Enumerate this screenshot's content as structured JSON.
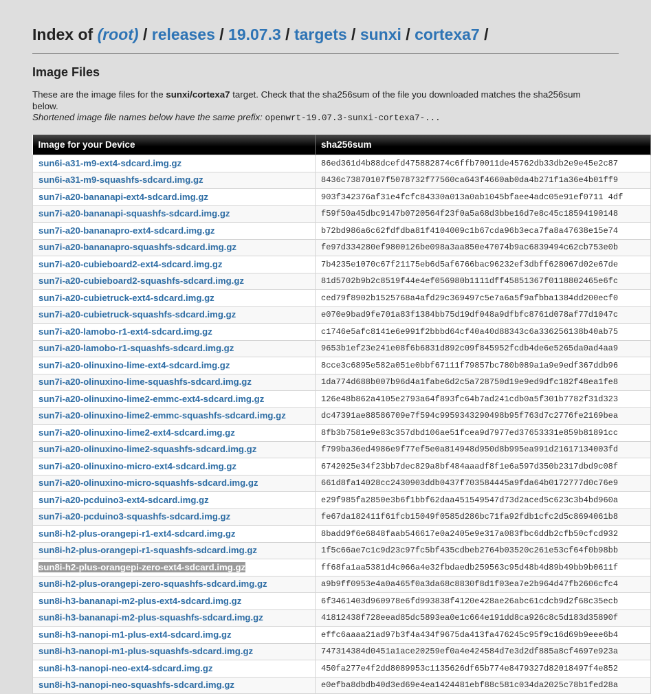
{
  "header": {
    "index_of": "Index of",
    "path": [
      {
        "label": "(root)",
        "italic": true
      },
      {
        "label": "releases"
      },
      {
        "label": "19.07.3"
      },
      {
        "label": "targets"
      },
      {
        "label": "sunxi"
      },
      {
        "label": "cortexa7"
      }
    ],
    "separator": "/"
  },
  "section": {
    "title": "Image Files",
    "intro_pre": "These are the image files for the ",
    "intro_target": "sunxi/cortexa7",
    "intro_post": " target. Check that the sha256sum of the file you downloaded matches the sha256sum below.",
    "short_label": "Shortened image file names below have the same prefix: ",
    "short_prefix": "openwrt-19.07.3-sunxi-cortexa7-..."
  },
  "table": {
    "col_image": "Image for your Device",
    "col_sha": "sha256sum",
    "selected_index": 24,
    "rows": [
      {
        "name": "sun6i-a31-m9-ext4-sdcard.img.gz",
        "sha": "86ed361d4b88dcefd475882874c6ffb70011de45762db33db2e9e45e2c87"
      },
      {
        "name": "sun6i-a31-m9-squashfs-sdcard.img.gz",
        "sha": "8436c73870107f5078732f77560ca643f4660ab0da4b271f1a36e4b01ff9"
      },
      {
        "name": "sun7i-a20-bananapi-ext4-sdcard.img.gz",
        "sha": "903f342376af31e4fcfc84330a013a0ab1045bfaee4adc05e91ef0711 4df"
      },
      {
        "name": "sun7i-a20-bananapi-squashfs-sdcard.img.gz",
        "sha": "f59f50a45dbc9147b0720564f23f0a5a68d3bbe16d7e8c45c18594190148"
      },
      {
        "name": "sun7i-a20-bananapro-ext4-sdcard.img.gz",
        "sha": "b72bd986a6c62fdfdba81f4104009c1b67cda96b3eca7fa8a47638e15e74"
      },
      {
        "name": "sun7i-a20-bananapro-squashfs-sdcard.img.gz",
        "sha": "fe97d334280ef9800126be098a3aa850e47074b9ac6839494c62cb753e0b"
      },
      {
        "name": "sun7i-a20-cubieboard2-ext4-sdcard.img.gz",
        "sha": "7b4235e1070c67f21175eb6d5af6766bac96232ef3dbff628067d02e67de"
      },
      {
        "name": "sun7i-a20-cubieboard2-squashfs-sdcard.img.gz",
        "sha": "81d5702b9b2c8519f44e4ef056980b1111dff45851367f0118802465e6fc"
      },
      {
        "name": "sun7i-a20-cubietruck-ext4-sdcard.img.gz",
        "sha": "ced79f8902b1525768a4afd29c369497c5e7a6a5f9afbba1384dd200ecf0"
      },
      {
        "name": "sun7i-a20-cubietruck-squashfs-sdcard.img.gz",
        "sha": "e070e9bad9fe701a83f1384bb75d19df048a9dfbfc8761d078af77d1047c"
      },
      {
        "name": "sun7i-a20-lamobo-r1-ext4-sdcard.img.gz",
        "sha": "c1746e5afc8141e6e991f2bbbd64cf40a40d88343c6a336256138b40ab75"
      },
      {
        "name": "sun7i-a20-lamobo-r1-squashfs-sdcard.img.gz",
        "sha": "9653b1ef23e241e08f6b6831d892c09f845952fcdb4de6e5265da0ad4aa9"
      },
      {
        "name": "sun7i-a20-olinuxino-lime-ext4-sdcard.img.gz",
        "sha": "8cce3c6895e582a051e0bbf67111f79857bc780b089a1a9e9edf367ddb96"
      },
      {
        "name": "sun7i-a20-olinuxino-lime-squashfs-sdcard.img.gz",
        "sha": "1da774d688b007b96d4a1fabe6d2c5a728750d19e9ed9dfc182f48ea1fe8"
      },
      {
        "name": "sun7i-a20-olinuxino-lime2-emmc-ext4-sdcard.img.gz",
        "sha": "126e48b862a4105e2793a64f893fc64b7ad241cdb0a5f301b7782f31d323"
      },
      {
        "name": "sun7i-a20-olinuxino-lime2-emmc-squashfs-sdcard.img.gz",
        "sha": "dc47391ae88586709e7f594c9959343290498b95f763d7c2776fe2169bea"
      },
      {
        "name": "sun7i-a20-olinuxino-lime2-ext4-sdcard.img.gz",
        "sha": "8fb3b7581e9e83c357dbd106ae51fcea9d7977ed37653331e859b81891cc"
      },
      {
        "name": "sun7i-a20-olinuxino-lime2-squashfs-sdcard.img.gz",
        "sha": "f799ba36ed4986e9f77ef5e0a814948d950d8b995ea991d21617134003fd"
      },
      {
        "name": "sun7i-a20-olinuxino-micro-ext4-sdcard.img.gz",
        "sha": "6742025e34f23bb7dec829a8bf484aaadf8f1e6a597d350b2317dbd9c08f"
      },
      {
        "name": "sun7i-a20-olinuxino-micro-squashfs-sdcard.img.gz",
        "sha": "661d8fa14028cc2430903ddb0437f703584445a9fda64b0172777d0c76e9"
      },
      {
        "name": "sun7i-a20-pcduino3-ext4-sdcard.img.gz",
        "sha": "e29f985fa2850e3b6f1bbf62daa451549547d73d2aced5c623c3b4bd960a"
      },
      {
        "name": "sun7i-a20-pcduino3-squashfs-sdcard.img.gz",
        "sha": "fe67da182411f61fcb15049f0585d286bc71fa92fdb1cfc2d5c8694061b8"
      },
      {
        "name": "sun8i-h2-plus-orangepi-r1-ext4-sdcard.img.gz",
        "sha": "8badd9f6e6848faab546617e0a2405e9e317a083fbc6ddb2cfb50cfcd932"
      },
      {
        "name": "sun8i-h2-plus-orangepi-r1-squashfs-sdcard.img.gz",
        "sha": "1f5c66ae7c1c9d23c97fc5bf435cdbeb2764b03520c261e53cf64f0b98bb"
      },
      {
        "name": "sun8i-h2-plus-orangepi-zero-ext4-sdcard.img.gz",
        "sha": "ff68fa1aa5381d4c066a4e32fbdaedb259563c95d48b4d89b49bb9b0611f"
      },
      {
        "name": "sun8i-h2-plus-orangepi-zero-squashfs-sdcard.img.gz",
        "sha": "a9b9ff0953e4a0a465f0a3da68c8830f8d1f03ea7e2b964d47fb2606cfc4"
      },
      {
        "name": "sun8i-h3-bananapi-m2-plus-ext4-sdcard.img.gz",
        "sha": "6f3461403d960978e6fd993838f4120e428ae26abc61cdcb9d2f68c35ecb"
      },
      {
        "name": "sun8i-h3-bananapi-m2-plus-squashfs-sdcard.img.gz",
        "sha": "41812438f728eead85dc5893ea0e1c664e191dd8ca926c8c5d183d35890f"
      },
      {
        "name": "sun8i-h3-nanopi-m1-plus-ext4-sdcard.img.gz",
        "sha": "effc6aaaa21ad97b3f4a434f9675da413fa476245c95f9c16d69b9eee6b4"
      },
      {
        "name": "sun8i-h3-nanopi-m1-plus-squashfs-sdcard.img.gz",
        "sha": "747314384d0451a1ace20259ef0a4e424584d7e3d2df885a8cf4697e923a"
      },
      {
        "name": "sun8i-h3-nanopi-neo-ext4-sdcard.img.gz",
        "sha": "450fa277e4f2dd8089953c1135626df65b774e8479327d82018497f4e852"
      },
      {
        "name": "sun8i-h3-nanopi-neo-squashfs-sdcard.img.gz",
        "sha": "e0efba8dbdb40d3ed69e4ea1424481ebf88c581c034da2025c78b1fed28a"
      }
    ]
  }
}
